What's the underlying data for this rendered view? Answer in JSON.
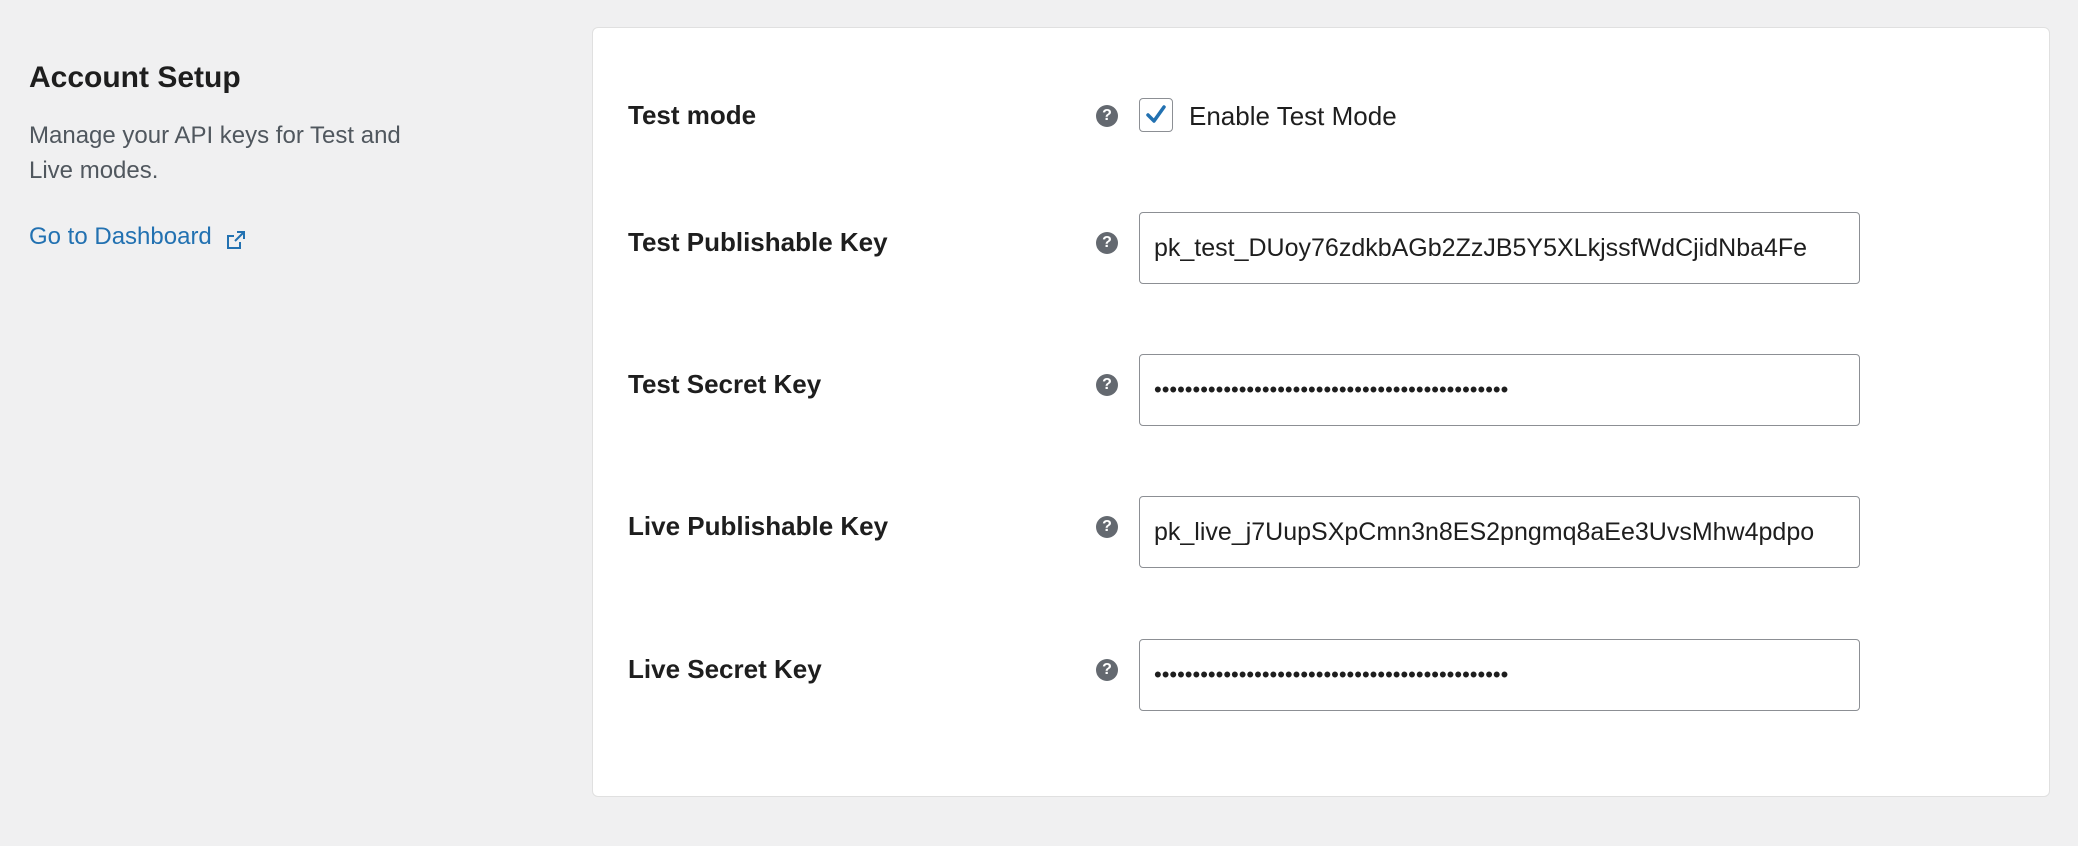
{
  "intro": {
    "title": "Account Setup",
    "description": "Manage your API keys for Test and Live modes.",
    "dashboard_link": "Go to Dashboard"
  },
  "settings": {
    "test_mode": {
      "label": "Test mode",
      "checkbox_label": "Enable Test Mode",
      "checked": true
    },
    "test_publishable_key": {
      "label": "Test Publishable Key",
      "value": "pk_test_DUoy76zdkbAGb2ZzJB5Y5XLkjssfWdCjidNba4Fe"
    },
    "test_secret_key": {
      "label": "Test Secret Key",
      "value": "••••••••••••••••••••••••••••••••••••••••••••••"
    },
    "live_publishable_key": {
      "label": "Live Publishable Key",
      "value": "pk_live_j7UupSXpCmn3n8ES2pngmq8aEe3UvsMhw4pdpo"
    },
    "live_secret_key": {
      "label": "Live Secret Key",
      "value": "••••••••••••••••••••••••••••••••••••••••••••••"
    }
  },
  "help_icon_glyph": "?",
  "colors": {
    "background": "#f0f0f1",
    "link": "#2271b1",
    "checkmark": "#2271b1",
    "help_icon": "#646970"
  }
}
